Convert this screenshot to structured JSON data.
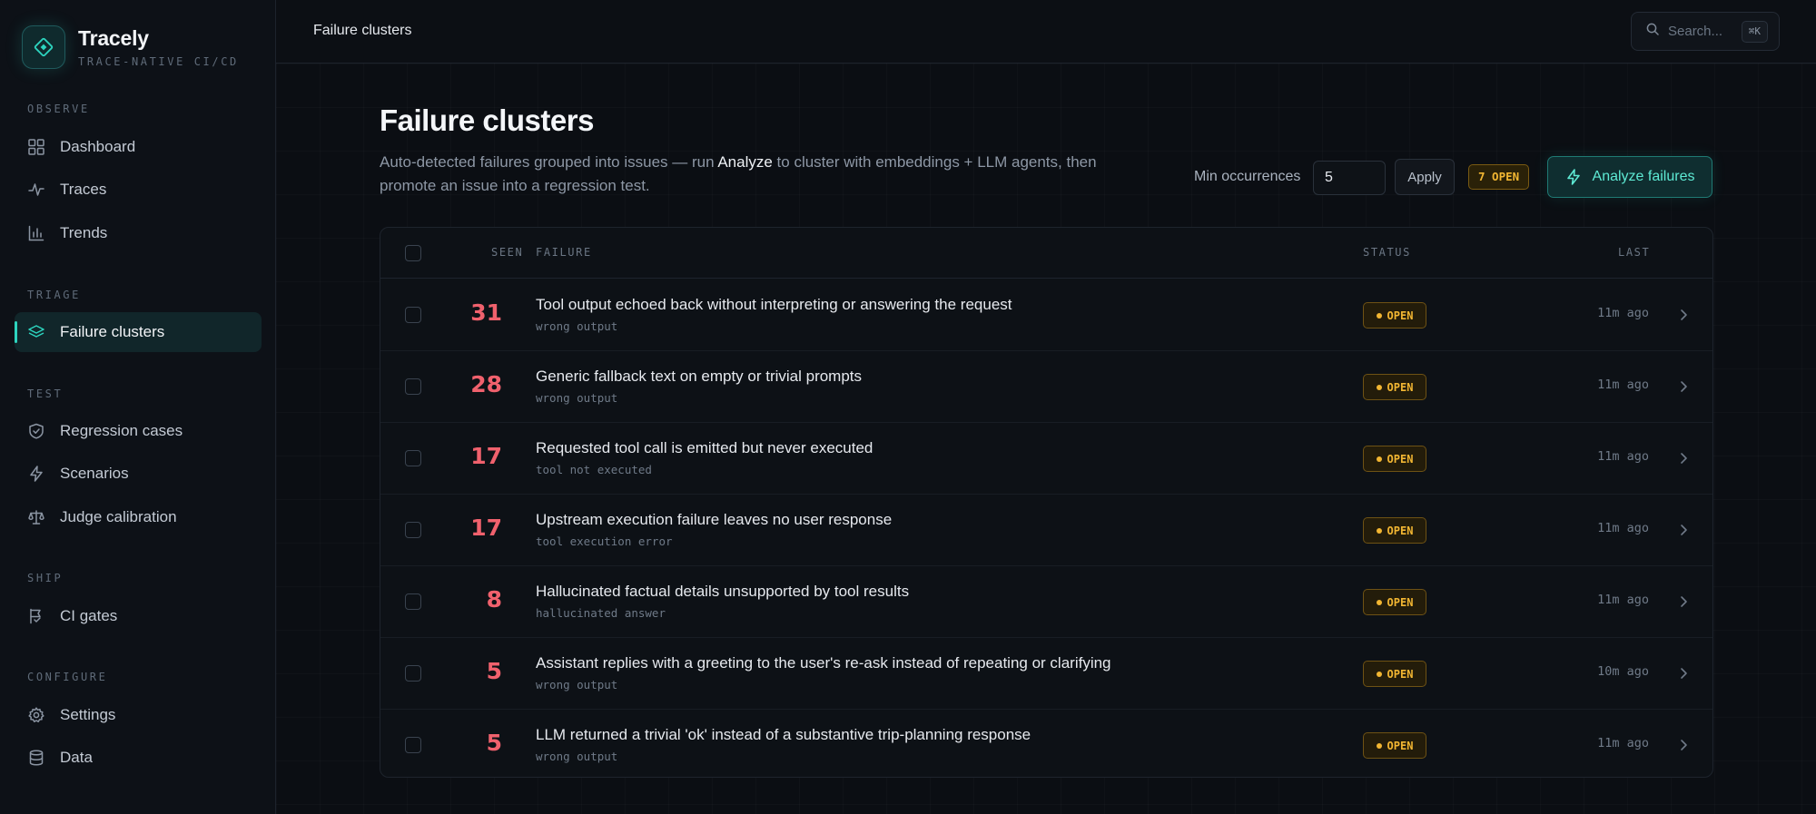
{
  "brand": {
    "name": "Tracely",
    "tagline": "TRACE-NATIVE CI/CD"
  },
  "sidebar": {
    "sections": [
      {
        "title": "OBSERVE",
        "items": [
          {
            "label": "Dashboard",
            "icon": "grid-icon"
          },
          {
            "label": "Traces",
            "icon": "activity-icon"
          },
          {
            "label": "Trends",
            "icon": "bar-chart-icon"
          }
        ]
      },
      {
        "title": "TRIAGE",
        "items": [
          {
            "label": "Failure clusters",
            "icon": "layers-icon",
            "active": true
          }
        ]
      },
      {
        "title": "TEST",
        "items": [
          {
            "label": "Regression cases",
            "icon": "shield-check-icon"
          },
          {
            "label": "Scenarios",
            "icon": "bolt-icon"
          },
          {
            "label": "Judge calibration",
            "icon": "scale-icon"
          }
        ]
      },
      {
        "title": "SHIP",
        "items": [
          {
            "label": "CI gates",
            "icon": "flag-icon"
          }
        ]
      },
      {
        "title": "CONFIGURE",
        "items": [
          {
            "label": "Settings",
            "icon": "gear-icon"
          },
          {
            "label": "Data",
            "icon": "database-icon"
          }
        ]
      }
    ]
  },
  "topbar": {
    "breadcrumb": "Failure clusters",
    "search": {
      "placeholder": "Search...",
      "shortcut": "⌘K"
    }
  },
  "page": {
    "title": "Failure clusters",
    "description_pre": "Auto-detected failures grouped into issues — run ",
    "description_highlight": "Analyze",
    "description_post": " to cluster with embeddings + LLM agents, then promote an issue into a regression test."
  },
  "controls": {
    "min_occurrences_label": "Min occurrences",
    "min_occurrences_value": "5",
    "apply_label": "Apply",
    "open_count_badge": "7 OPEN",
    "analyze_label": "Analyze failures"
  },
  "table": {
    "columns": {
      "seen": "SEEN",
      "failure": "FAILURE",
      "status": "STATUS",
      "last": "LAST"
    },
    "rows": [
      {
        "seen": "31",
        "title": "Tool output echoed back without interpreting or answering the request",
        "category": "wrong output",
        "status": "OPEN",
        "last": "11m ago"
      },
      {
        "seen": "28",
        "title": "Generic fallback text on empty or trivial prompts",
        "category": "wrong output",
        "status": "OPEN",
        "last": "11m ago"
      },
      {
        "seen": "17",
        "title": "Requested tool call is emitted but never executed",
        "category": "tool not executed",
        "status": "OPEN",
        "last": "11m ago"
      },
      {
        "seen": "17",
        "title": "Upstream execution failure leaves no user response",
        "category": "tool execution error",
        "status": "OPEN",
        "last": "11m ago"
      },
      {
        "seen": "8",
        "title": "Hallucinated factual details unsupported by tool results",
        "category": "hallucinated answer",
        "status": "OPEN",
        "last": "11m ago"
      },
      {
        "seen": "5",
        "title": "Assistant replies with a greeting to the user's re-ask instead of repeating or clarifying",
        "category": "wrong output",
        "status": "OPEN",
        "last": "10m ago"
      },
      {
        "seen": "5",
        "title": "LLM returned a trivial 'ok' instead of a substantive trip-planning response",
        "category": "wrong output",
        "status": "OPEN",
        "last": "11m ago"
      }
    ]
  },
  "colors": {
    "accent": "#2dd4bf",
    "warning": "#f2b632",
    "count": "#f0616d",
    "background": "#0b0e13"
  }
}
